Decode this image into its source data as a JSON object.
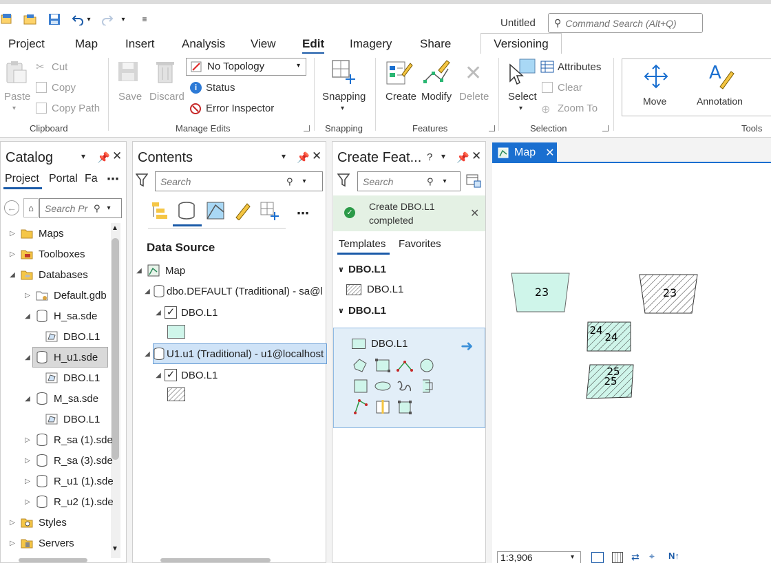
{
  "title_bar": {
    "doc_title": "Untitled",
    "command_search_placeholder": "Command Search (Alt+Q)"
  },
  "ribbon_tabs": [
    "Project",
    "Map",
    "Insert",
    "Analysis",
    "View",
    "Edit",
    "Imagery",
    "Share",
    "Versioning"
  ],
  "active_tab": "Edit",
  "ribbon": {
    "clipboard": {
      "paste": "Paste",
      "cut": "Cut",
      "copy": "Copy",
      "copy_path": "Copy Path",
      "group": "Clipboard"
    },
    "manage_edits": {
      "save": "Save",
      "discard": "Discard",
      "topology": "No Topology",
      "status": "Status",
      "error_inspector": "Error Inspector",
      "group": "Manage Edits"
    },
    "snapping": {
      "snapping": "Snapping",
      "group": "Snapping"
    },
    "features": {
      "create": "Create",
      "modify": "Modify",
      "delete": "Delete",
      "group": "Features"
    },
    "selection": {
      "select": "Select",
      "attributes": "Attributes",
      "clear": "Clear",
      "zoom_to": "Zoom To",
      "group": "Selection"
    },
    "tools": {
      "move": "Move",
      "annotation": "Annotation",
      "group": "Tools"
    }
  },
  "catalog": {
    "title": "Catalog",
    "tabs": [
      "Project",
      "Portal",
      "Fa"
    ],
    "search_placeholder": "Search Pr",
    "items": [
      "Maps",
      "Toolboxes",
      "Databases",
      "Default.gdb",
      "H_sa.sde",
      "DBO.L1",
      "H_u1.sde",
      "DBO.L1",
      "M_sa.sde",
      "DBO.L1",
      "R_sa (1).sde",
      "R_sa (3).sde",
      "R_u1 (1).sde",
      "R_u2 (1).sde",
      "Styles",
      "Servers"
    ]
  },
  "contents": {
    "title": "Contents",
    "search_placeholder": "Search",
    "heading": "Data Source",
    "map": "Map",
    "db1": "dbo.DEFAULT (Traditional) - sa@l",
    "layer1": "DBO.L1",
    "db2": "U1.u1 (Traditional) - u1@localhost",
    "layer2": "DBO.L1"
  },
  "create_features": {
    "title": "Create Feat...",
    "search_placeholder": "Search",
    "message_line1": "Create DBO.L1",
    "message_line2": "completed",
    "tabs": [
      "Templates",
      "Favorites"
    ],
    "group1": "DBO.L1",
    "template1": "DBO.L1",
    "group2": "DBO.L1",
    "template2": "DBO.L1"
  },
  "map": {
    "tab_label": "Map",
    "scale": "1:3,906",
    "features": [
      {
        "label": "23"
      },
      {
        "label": "23"
      },
      {
        "label": "24",
        "label2": "24"
      },
      {
        "label": "25",
        "label2": "25"
      }
    ]
  },
  "colors": {
    "accent": "#1a6fd0",
    "feature_fill": "#cff5ea",
    "selected_row": "#cfe3f7",
    "banner": "#e4f1e4"
  }
}
